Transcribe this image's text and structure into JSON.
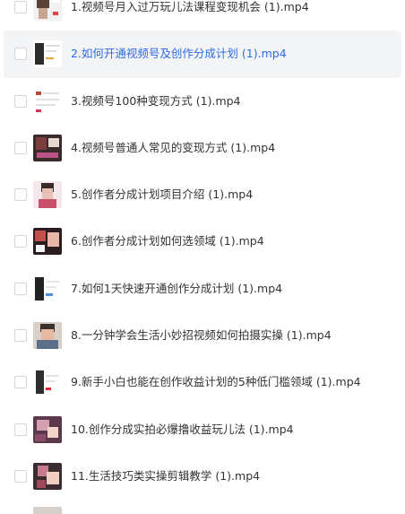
{
  "files": [
    {
      "name": "1.视频号月入过万玩儿法课程变现机会 (1).mp4",
      "thumb": "thumb-style-a",
      "selected": false
    },
    {
      "name": "2.如何开通视频号及创作分成计划 (1).mp4",
      "thumb": "thumb-style-b",
      "selected": true
    },
    {
      "name": "3.视频号100种变现方式 (1).mp4",
      "thumb": "thumb-style-c",
      "selected": false
    },
    {
      "name": "4.视频号普通人常见的变现方式 (1).mp4",
      "thumb": "thumb-style-d",
      "selected": false
    },
    {
      "name": "5.创作者分成计划项目介绍 (1).mp4",
      "thumb": "thumb-style-e",
      "selected": false
    },
    {
      "name": "6.创作者分成计划如何选领域 (1).mp4",
      "thumb": "thumb-style-f",
      "selected": false
    },
    {
      "name": "7.如何1天快速开通创作分成计划 (1).mp4",
      "thumb": "thumb-style-g",
      "selected": false
    },
    {
      "name": "8.一分钟学会生活小妙招视频如何拍摄实操 (1).mp4",
      "thumb": "thumb-style-h",
      "selected": false
    },
    {
      "name": "9.新手小白也能在创作收益计划的5种低门槛领域 (1).mp4",
      "thumb": "thumb-style-i",
      "selected": false
    },
    {
      "name": "10.创作分成实拍必爆撸收益玩儿法 (1).mp4",
      "thumb": "thumb-style-j",
      "selected": false
    },
    {
      "name": "11.生活技巧类实操剪辑教学 (1).mp4",
      "thumb": "thumb-style-k",
      "selected": false
    }
  ],
  "colors": {
    "selected_text": "#2e6be6",
    "text": "#333333",
    "selected_bg": "#f3f4f6"
  }
}
